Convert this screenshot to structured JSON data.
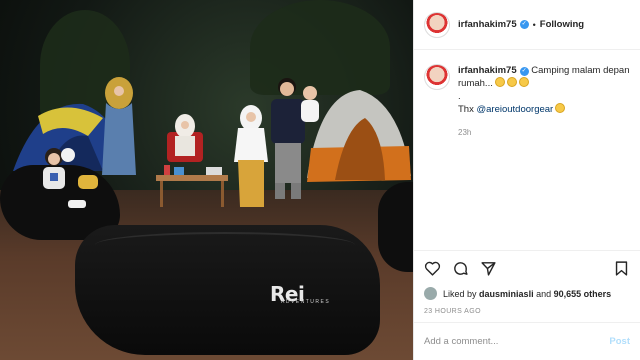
{
  "post": {
    "username": "irfanhakim75",
    "follow_label": "Following",
    "separator": "•",
    "caption_text": "Camping malam depan rumah...",
    "caption_thanks": "Thx",
    "caption_mention": "@areioutdoorgear",
    "time_ago_short": "23h",
    "liked_by_prefix": "Liked by",
    "liked_by_user": "dausminiasli",
    "liked_by_and": "and",
    "likes_others": "90,655 others",
    "time_ago_long": "23 HOURS AGO",
    "comment_placeholder": "Add a comment...",
    "post_button": "Post",
    "photo_logo_brand": "Rei",
    "photo_logo_sub": "ADVENTURES"
  },
  "icons": [
    "heart-icon",
    "comment-icon",
    "share-icon",
    "bookmark-icon",
    "verified-badge-icon",
    "laughing-emoji-icon"
  ],
  "colors": {
    "verified": "#3897f0",
    "mention": "#00376b",
    "muted": "#8e8e8e",
    "post_button": "#b2dffc"
  }
}
